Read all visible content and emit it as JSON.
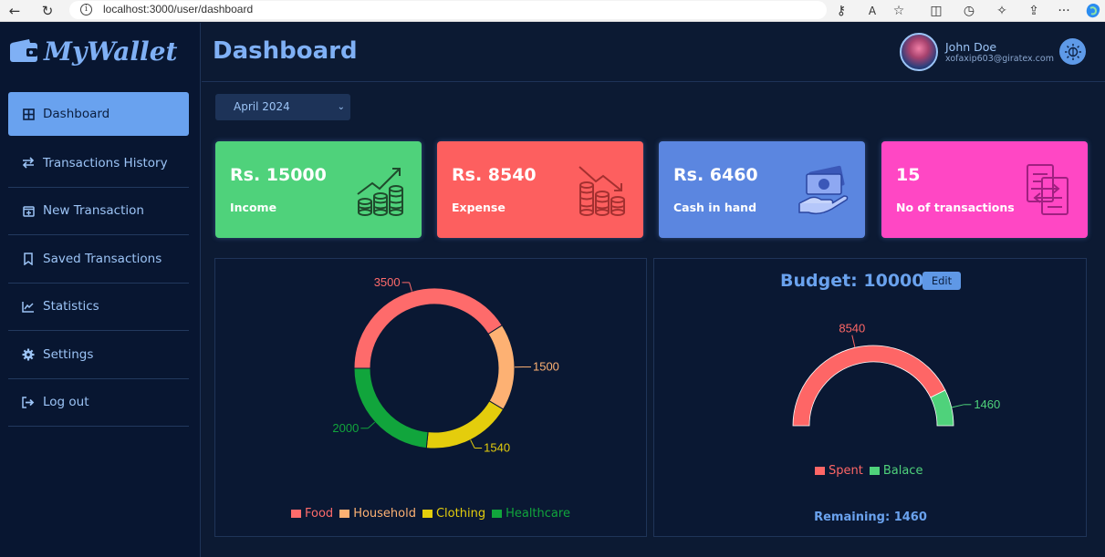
{
  "browser": {
    "url": "localhost:3000/user/dashboard"
  },
  "app": {
    "logo_text": "MyWallet"
  },
  "sidebar": {
    "items": [
      {
        "label": "Dashboard",
        "icon": "grid-icon",
        "active": true
      },
      {
        "label": "Transactions History",
        "icon": "swap-arrows-icon",
        "active": false
      },
      {
        "label": "New Transaction",
        "icon": "calendar-plus-icon",
        "active": false
      },
      {
        "label": "Saved Transactions",
        "icon": "bookmark-icon",
        "active": false
      },
      {
        "label": "Statistics",
        "icon": "line-chart-icon",
        "active": false
      },
      {
        "label": "Settings",
        "icon": "gear-icon",
        "active": false
      },
      {
        "label": "Log out",
        "icon": "logout-icon",
        "active": false
      }
    ]
  },
  "header": {
    "title": "Dashboard",
    "user_name": "John Doe",
    "user_email": "xofaxip603@giratex.com"
  },
  "filter": {
    "month": "April 2024"
  },
  "cards": [
    {
      "value": "Rs. 15000",
      "label": "Income",
      "color": "#4fd27b",
      "icon": "coins-growth-icon"
    },
    {
      "value": "Rs. 8540",
      "label": "Expense",
      "color": "#fd5f5f",
      "icon": "coins-decline-icon"
    },
    {
      "value": "Rs. 6460",
      "label": "Cash in hand",
      "color": "#5b86e0",
      "icon": "cash-hand-icon"
    },
    {
      "value": "15",
      "label": "No of transactions",
      "color": "#ff47c4",
      "icon": "transfer-document-icon"
    }
  ],
  "chart_data": [
    {
      "type": "pie",
      "categories": [
        "Food",
        "Household",
        "Clothing",
        "Healthcare"
      ],
      "values": [
        3500,
        1500,
        1540,
        2000
      ],
      "data_labels": [
        "3500",
        "1500",
        "1540",
        "2000"
      ],
      "colors": [
        "#fe6b6b",
        "#fdb173",
        "#e4cd0c",
        "#11a53c"
      ],
      "donut": true,
      "legend": "bottom"
    },
    {
      "type": "pie",
      "title": "Budget: 10000",
      "categories": [
        "Spent",
        "Balace"
      ],
      "values": [
        8540,
        1460
      ],
      "data_labels": [
        "8540",
        "1460"
      ],
      "colors": [
        "#fe6666",
        "#4fd27b"
      ],
      "semi_circle": true,
      "legend": "bottom"
    }
  ],
  "budget": {
    "edit_label": "Edit",
    "remaining": "Remaining: 1460"
  }
}
